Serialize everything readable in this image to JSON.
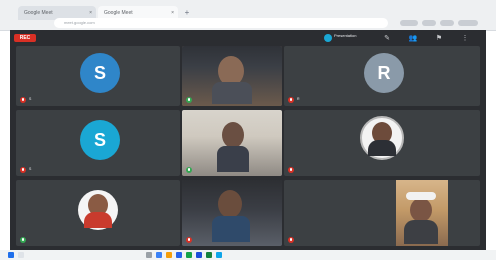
{
  "browser": {
    "tabs": [
      {
        "label": "Google Meet"
      },
      {
        "label": "Google Meet"
      }
    ],
    "new_tab_icon": "plus-icon",
    "url": "meet.google.com"
  },
  "meeting": {
    "recording_label": "REC",
    "presentation_label": "Presentation",
    "toolbar_icons": [
      "chat-icon",
      "people-icon",
      "activities-icon",
      "more-icon"
    ],
    "participants": [
      {
        "name": "S",
        "avatar_letter": "S",
        "kind": "initial",
        "mic": "muted",
        "avatar_color": "#2f86c9"
      },
      {
        "name": "",
        "kind": "video",
        "mic": "active"
      },
      {
        "name": "R",
        "avatar_letter": "R",
        "kind": "initial",
        "mic": "muted",
        "avatar_color": "#8a9aa9"
      },
      {
        "name": "S",
        "avatar_letter": "S",
        "kind": "initial",
        "mic": "muted",
        "avatar_color": "#1aa7d4"
      },
      {
        "name": "",
        "kind": "video",
        "mic": "active"
      },
      {
        "name": "",
        "kind": "photo",
        "mic": "muted"
      },
      {
        "name": "",
        "kind": "photo",
        "mic": "active"
      },
      {
        "name": "",
        "kind": "video",
        "mic": "muted"
      },
      {
        "name": "",
        "kind": "video",
        "mic": "muted"
      }
    ]
  },
  "taskbar": {
    "icons": [
      "windows-icon",
      "search-icon",
      "task-view-icon",
      "browser-icon",
      "folder-icon",
      "mail-icon",
      "chrome-icon",
      "word-icon",
      "excel-icon",
      "camera-icon"
    ]
  }
}
